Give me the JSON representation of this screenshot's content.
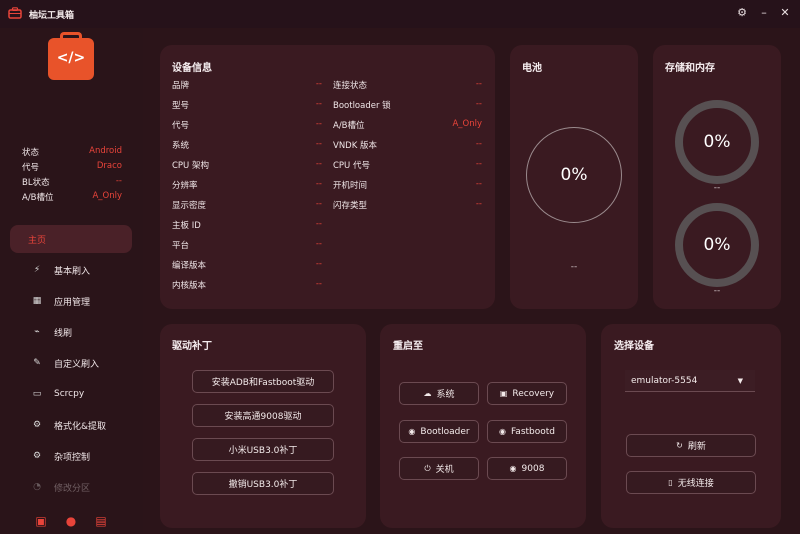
{
  "app": {
    "title": "柚坛工具箱"
  },
  "window_icons": {
    "settings": "gear-icon",
    "minimize": "minimize-icon",
    "close": "close-icon"
  },
  "colors": {
    "accent": "#e8443a",
    "card": "#3a1a21",
    "background": "#2b1419"
  },
  "sidebar": {
    "logo_code": "</>",
    "status": [
      {
        "key": "状态",
        "value": "Android"
      },
      {
        "key": "代号",
        "value": "Draco"
      },
      {
        "key": "BL状态",
        "value": "--"
      },
      {
        "key": "A/B槽位",
        "value": "A_Only"
      }
    ],
    "nav": [
      {
        "label": "主页",
        "icon": "",
        "active": true
      },
      {
        "label": "基本刷入",
        "icon": "flash-icon"
      },
      {
        "label": "应用管理",
        "icon": "apps-icon"
      },
      {
        "label": "线刷",
        "icon": "cable-icon"
      },
      {
        "label": "自定义刷入",
        "icon": "wand-icon"
      },
      {
        "label": "Scrcpy",
        "icon": "screen-icon"
      },
      {
        "label": "格式化&提取",
        "icon": "format-icon"
      },
      {
        "label": "杂项控制",
        "icon": "misc-icon"
      },
      {
        "label": "修改分区",
        "icon": "partition-icon"
      }
    ],
    "bottom_icons": [
      "terminal-icon",
      "github-icon",
      "chat-icon"
    ]
  },
  "device_info": {
    "title": "设备信息",
    "left": [
      {
        "key": "品牌",
        "value": "--"
      },
      {
        "key": "型号",
        "value": "--"
      },
      {
        "key": "代号",
        "value": "--"
      },
      {
        "key": "系统",
        "value": "--"
      },
      {
        "key": "CPU 架构",
        "value": "--"
      },
      {
        "key": "分辨率",
        "value": "--"
      },
      {
        "key": "显示密度",
        "value": "--"
      },
      {
        "key": "主板 ID",
        "value": "--"
      },
      {
        "key": "平台",
        "value": "--"
      },
      {
        "key": "编译版本",
        "value": "--"
      },
      {
        "key": "内核版本",
        "value": "--"
      }
    ],
    "right": [
      {
        "key": "连接状态",
        "value": "--"
      },
      {
        "key": "Bootloader 锁",
        "value": "--"
      },
      {
        "key": "A/B槽位",
        "value": "A_Only"
      },
      {
        "key": "VNDK 版本",
        "value": "--"
      },
      {
        "key": "CPU 代号",
        "value": "--"
      },
      {
        "key": "开机时间",
        "value": "--"
      },
      {
        "key": "闪存类型",
        "value": "--"
      }
    ]
  },
  "battery": {
    "title": "电池",
    "percent": "0%",
    "sub": "--"
  },
  "storage": {
    "title": "存储和内存",
    "storage_percent": "0%",
    "storage_sub": "--",
    "memory_percent": "0%",
    "memory_sub": "--"
  },
  "driver": {
    "title": "驱动补丁",
    "buttons": [
      "安装ADB和Fastboot驱动",
      "安装高通9008驱动",
      "小米USB3.0补丁",
      "撤销USB3.0补丁"
    ]
  },
  "reboot": {
    "title": "重启至",
    "buttons": [
      {
        "label": "系统",
        "icon": "cloud-icon"
      },
      {
        "label": "Recovery",
        "icon": "recovery-icon"
      },
      {
        "label": "Bootloader",
        "icon": "bootloader-icon"
      },
      {
        "label": "Fastbootd",
        "icon": "fastbootd-icon"
      },
      {
        "label": "关机",
        "icon": "power-icon"
      },
      {
        "label": "9008",
        "icon": "edl-icon"
      }
    ]
  },
  "device_select": {
    "title": "选择设备",
    "selected": "emulator-5554",
    "refresh_label": "刷新",
    "wireless_label": "无线连接"
  }
}
